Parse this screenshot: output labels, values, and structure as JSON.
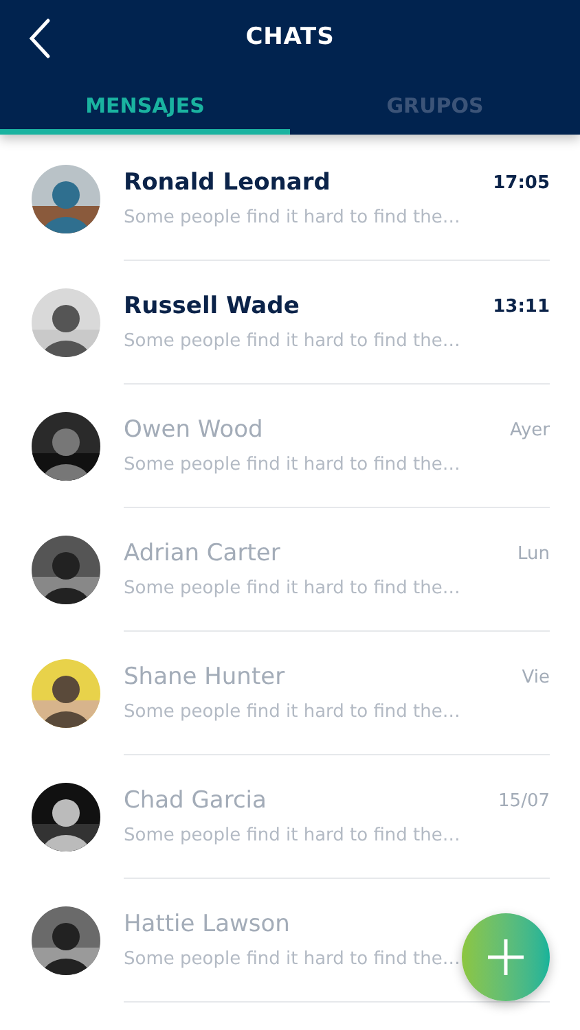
{
  "header": {
    "title": "CHATS"
  },
  "tabs": [
    {
      "label": "MENSAJES",
      "selected": true
    },
    {
      "label": "GRUPOS",
      "selected": false
    }
  ],
  "chats": [
    {
      "name": "Ronald Leonard",
      "preview": "Some people find it hard to find the…",
      "time": "17:05",
      "unread": true
    },
    {
      "name": "Russell Wade",
      "preview": "Some people find it hard to find the…",
      "time": "13:11",
      "unread": true
    },
    {
      "name": "Owen Wood",
      "preview": "Some people find it hard to find the…",
      "time": "Ayer",
      "unread": false
    },
    {
      "name": "Adrian Carter",
      "preview": "Some people find it hard to find the…",
      "time": "Lun",
      "unread": false
    },
    {
      "name": "Shane Hunter",
      "preview": "Some people find it hard to find the…",
      "time": "Vie",
      "unread": false
    },
    {
      "name": "Chad Garcia",
      "preview": "Some people find it hard to find the…",
      "time": "15/07",
      "unread": false
    },
    {
      "name": "Hattie Lawson",
      "preview": "Some people find it hard to find the…",
      "unread": false
    }
  ]
}
